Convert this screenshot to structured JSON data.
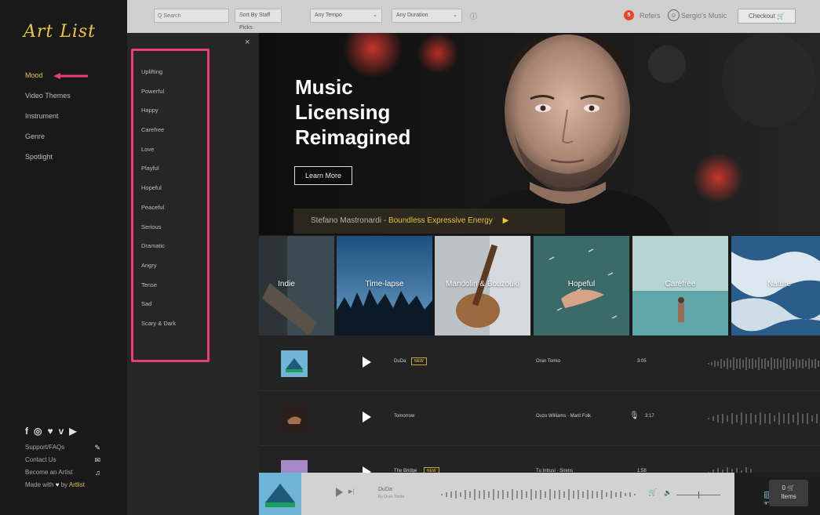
{
  "logo": "Art List",
  "sidebar": {
    "nav": [
      "Mood",
      "Video Themes",
      "Instrument",
      "Genre",
      "Spotlight"
    ],
    "active_index": 0,
    "social": [
      "f",
      "◎",
      "♥",
      "v",
      "▶"
    ],
    "footer_links": [
      {
        "label": "Support/FAQs",
        "icon": "✎"
      },
      {
        "label": "Contact Us",
        "icon": "✉"
      },
      {
        "label": "Become an Artist",
        "icon": "♫"
      }
    ],
    "made_with": "Made with",
    "by": "by",
    "artlist": "Artlist"
  },
  "mood_panel": {
    "close": "×",
    "items": [
      "Uplifting",
      "Powerful",
      "Happy",
      "Carefree",
      "Love",
      "Playful",
      "Hopeful",
      "Peaceful",
      "Serious",
      "Dramatic",
      "Angry",
      "Tense",
      "Sad",
      "Scary & Dark"
    ]
  },
  "topbar": {
    "search_placeholder": "Q Search",
    "sort": "Sort By Staff Picks",
    "tempo": "Any Tempo",
    "duration": "Any Duration",
    "info": "ⓘ",
    "refer_count": "5",
    "refers": "Refers",
    "user": "Sergio's Music",
    "checkout": "Checkout"
  },
  "hero": {
    "title_line1": "Music",
    "title_line2": "Licensing",
    "title_line3": "Reimagined",
    "learn_more": "Learn More",
    "featured_artist": "Stefano Mastronardi",
    "featured_sep": " - ",
    "featured_track": "Boundless Expressive Energy"
  },
  "carousel": [
    "Indie",
    "Time-lapse",
    "Mandolin & Bouzouki",
    "Hopeful",
    "Carefree",
    "Nature"
  ],
  "tracks": [
    {
      "name": "DuDa",
      "new": "NEW",
      "artist": "Oran Tomio",
      "duration": "3:05",
      "vocal": false
    },
    {
      "name": "Tomorrow",
      "new": "",
      "artist": "Ouzo Williams · Marit Folk",
      "duration": "3:17",
      "vocal": true
    },
    {
      "name": "The Bridge",
      "new": "NEW",
      "artist": "Tu Intrusi · Sirens",
      "duration": "1:58",
      "vocal": false
    }
  ],
  "player": {
    "title": "DuDa",
    "subtitle": "By Oran Tomio",
    "items_count": "0",
    "items_label": "Items"
  },
  "colors": {
    "accent_gold": "#e7c04a",
    "highlight_pink": "#ec3e73",
    "badge_red": "#e8452c"
  }
}
